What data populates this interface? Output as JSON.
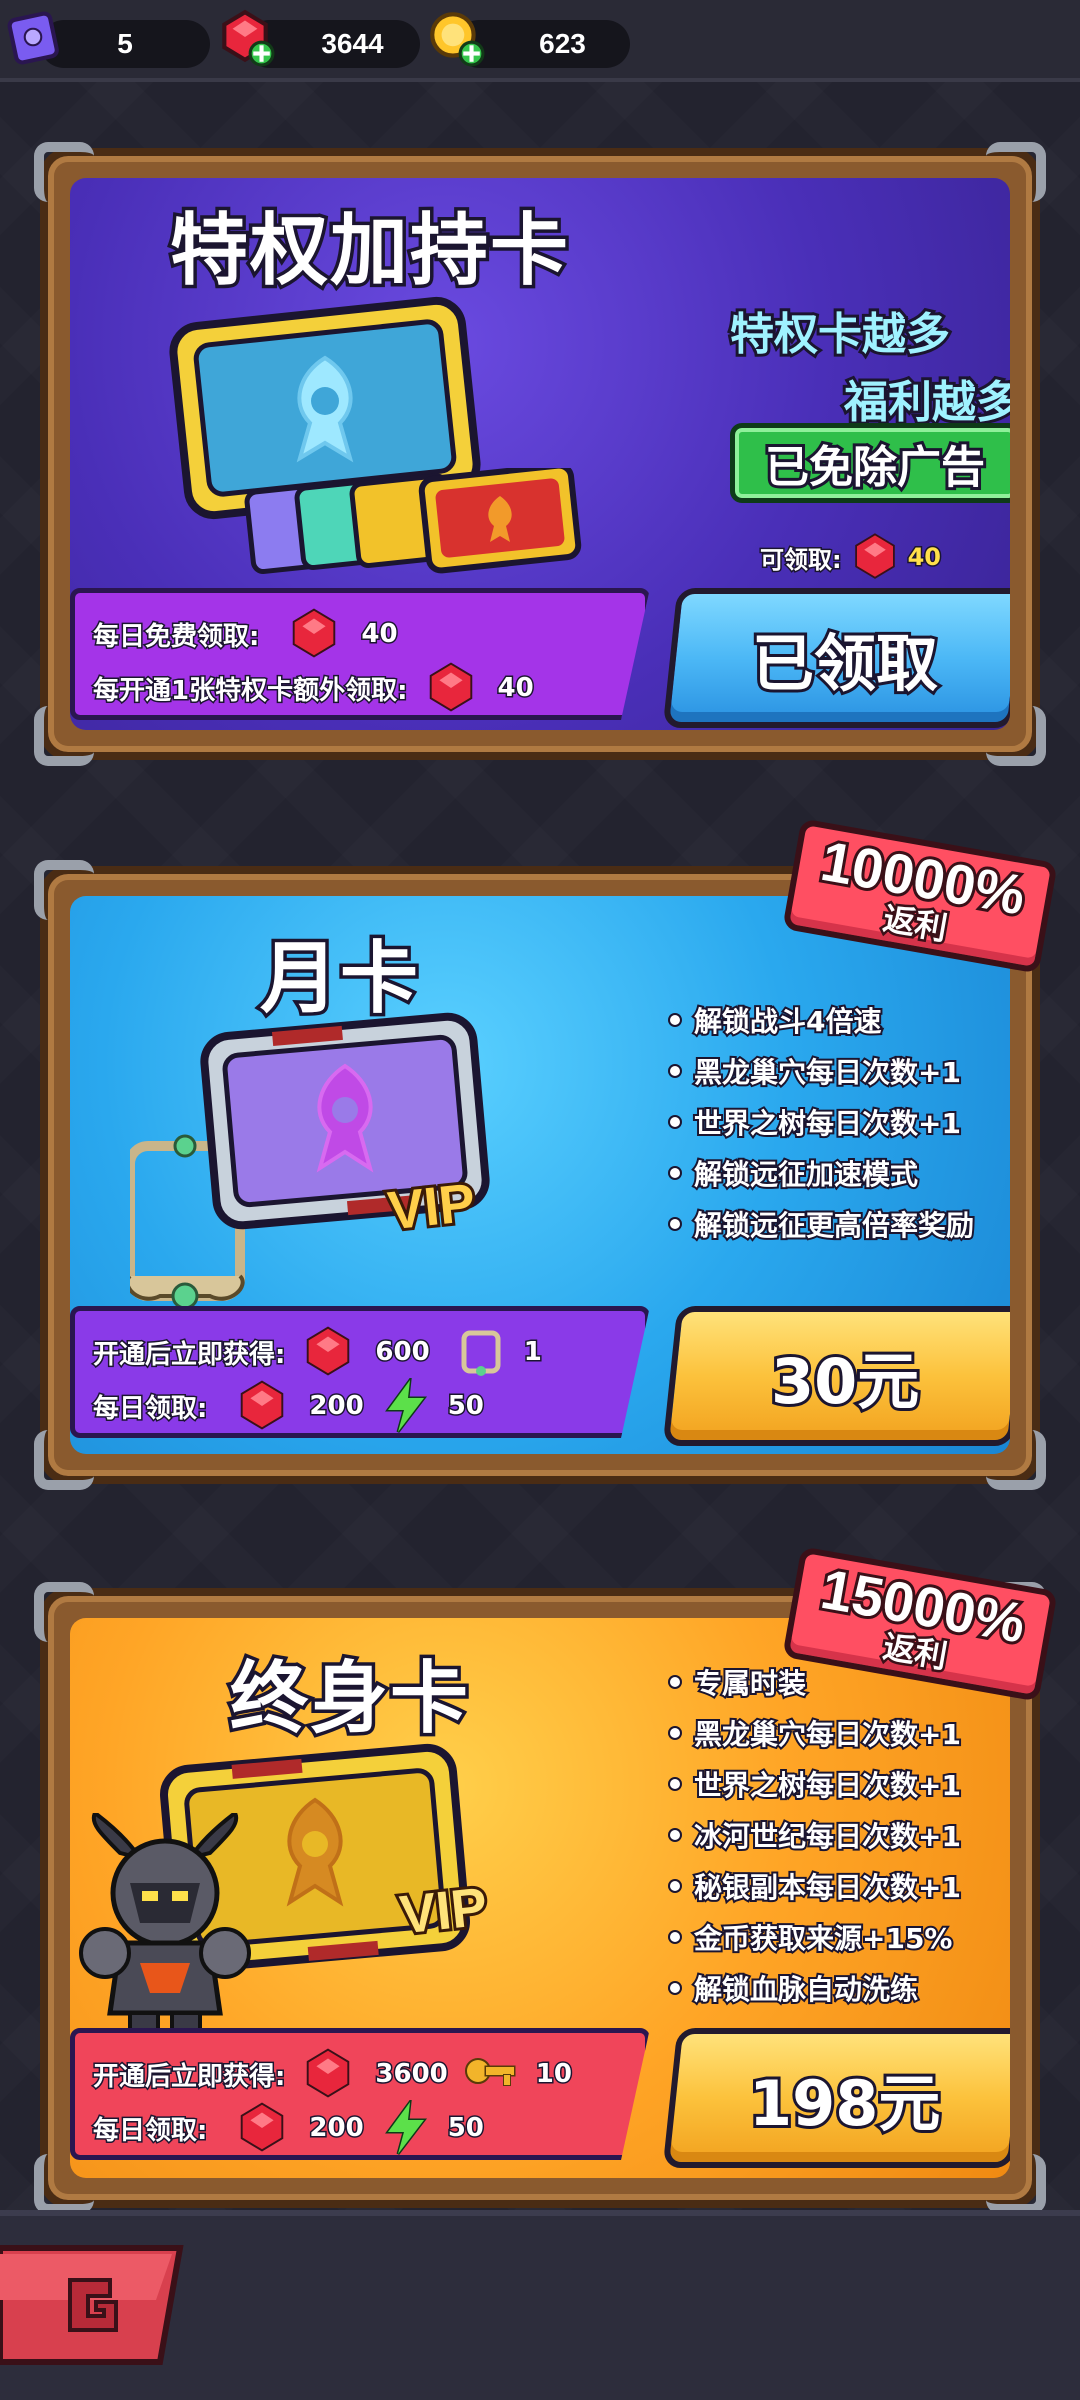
{
  "currencies": [
    {
      "name": "tickets",
      "value": "5",
      "icon": "purple-book-icon"
    },
    {
      "name": "gems",
      "value": "3644",
      "icon": "red-gem-plus-icon"
    },
    {
      "name": "gold",
      "value": "623",
      "icon": "gold-coin-plus-icon"
    }
  ],
  "privilege_card": {
    "title": "特权加持卡",
    "slogan_line1": "特权卡越多",
    "slogan_line2": "福利越多",
    "ad_removed": "已免除广告",
    "claimable_label": "可领取:",
    "claimable_value": "40",
    "daily_free_label": "每日免费领取:",
    "daily_free_value": "40",
    "per_card_label": "每开通1张特权卡额外领取:",
    "per_card_value": "40",
    "button": "已领取"
  },
  "monthly_card": {
    "title": "月卡",
    "ribbon_percent": "10000%",
    "ribbon_label": "返利",
    "vip_text": "VIP",
    "benefits": [
      "解锁战斗4倍速",
      "黑龙巢穴每日次数+1",
      "世界之树每日次数+1",
      "解锁远征加速模式",
      "解锁远征更高倍率奖励"
    ],
    "instant_label": "开通后立即获得:",
    "instant_gems": "600",
    "instant_frame": "1",
    "daily_label": "每日领取:",
    "daily_gems": "200",
    "daily_energy": "50",
    "price": "30元"
  },
  "lifetime_card": {
    "title": "终身卡",
    "ribbon_percent": "15000%",
    "ribbon_label": "返利",
    "vip_text": "VIP",
    "benefits": [
      "专属时装",
      "黑龙巢穴每日次数+1",
      "世界之树每日次数+1",
      "冰河世纪每日次数+1",
      "秘银副本每日次数+1",
      "金币获取来源+15%",
      "解锁血脉自动洗练"
    ],
    "instant_label": "开通后立即获得:",
    "instant_gems": "3600",
    "instant_keys": "10",
    "daily_label": "每日领取:",
    "daily_gems": "200",
    "daily_energy": "50",
    "price": "198元"
  },
  "colors": {
    "background": "#23232f",
    "frame_brown": "#8a5a2e",
    "purple_panel": "#4a2fb8",
    "blue_panel": "#2aa8ee",
    "orange_panel": "#ffa526",
    "ribbon_red": "#ff4f62",
    "gem_red": "#e8263c",
    "ad_green": "#2fbf4a"
  }
}
